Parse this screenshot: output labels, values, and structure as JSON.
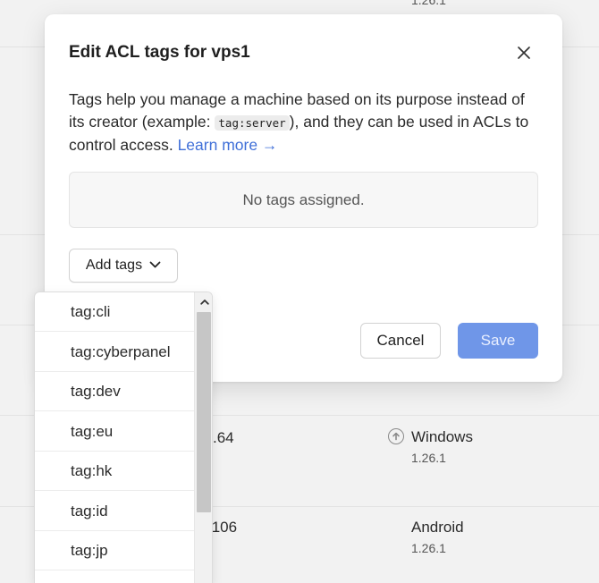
{
  "background": {
    "top_version": "1.26.1",
    "row1": {
      "address_fragment": ".64",
      "os": "Windows",
      "version": "1.26.1"
    },
    "row2": {
      "address_fragment": ".106",
      "os": "Android",
      "version": "1.26.1"
    }
  },
  "dialog": {
    "title": "Edit ACL tags for vps1",
    "description": {
      "part1": "Tags help you manage a machine based on its purpose instead of its creator (example: ",
      "code": "tag:server",
      "part2": "), and they can be used in ACLs to control access. ",
      "link": "Learn more →"
    },
    "empty_state": "No tags assigned.",
    "add_tags_label": "Add tags",
    "cancel_label": "Cancel",
    "save_label": "Save"
  },
  "dropdown": {
    "options": [
      "tag:cli",
      "tag:cyberpanel",
      "tag:dev",
      "tag:eu",
      "tag:hk",
      "tag:id",
      "tag:jp"
    ]
  },
  "colors": {
    "accent": "#6f96e8",
    "link": "#3f6fd8"
  }
}
